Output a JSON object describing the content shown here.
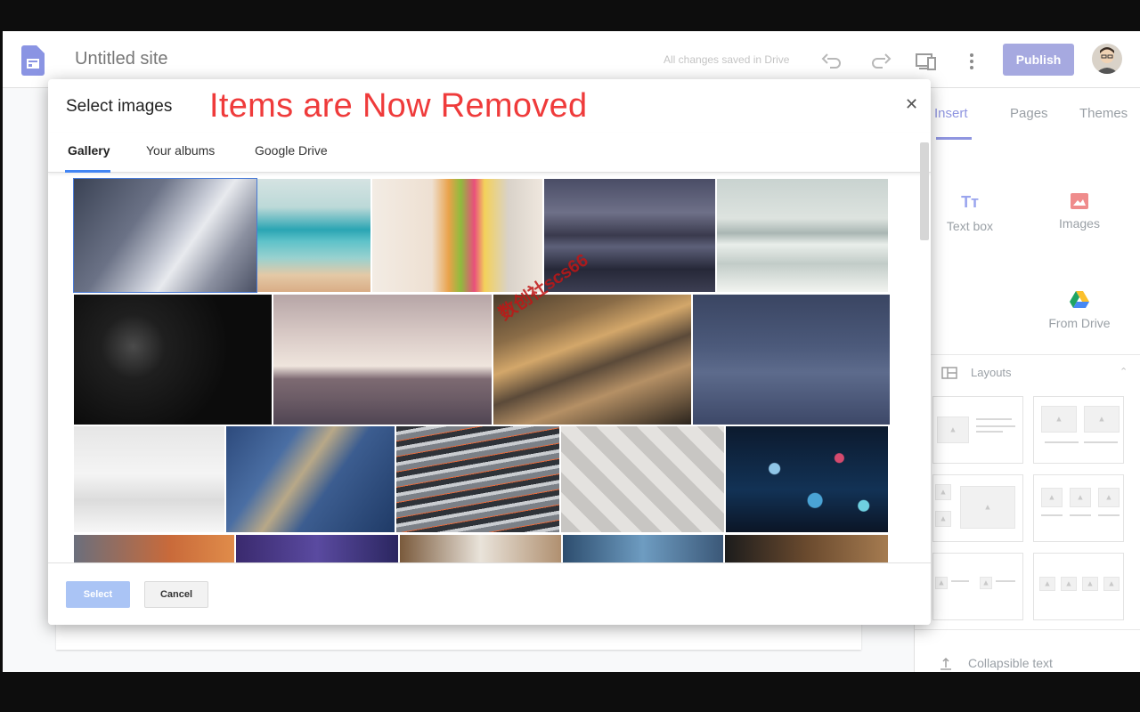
{
  "header": {
    "site_title": "Untitled site",
    "save_status": "All changes saved in Drive",
    "publish_label": "Publish"
  },
  "right_panel": {
    "tabs": [
      "Insert",
      "Pages",
      "Themes"
    ],
    "active_tab": "Insert",
    "items": {
      "text_box": "Text box",
      "images": "Images",
      "from_drive": "From Drive"
    },
    "layouts_label": "Layouts",
    "collapsible_text": "Collapsible text"
  },
  "dialog": {
    "title": "Select images",
    "overlay_note": "Items are Now Removed",
    "tabs": [
      "Gallery",
      "Your albums",
      "Google Drive"
    ],
    "active_tab": "Gallery",
    "select_label": "Select",
    "cancel_label": "Cancel",
    "images": [
      {
        "name": "diagonal-planks"
      },
      {
        "name": "teal-sea"
      },
      {
        "name": "sticky-notes"
      },
      {
        "name": "ice-lake"
      },
      {
        "name": "frozen-shore"
      },
      {
        "name": "typewriter-keys"
      },
      {
        "name": "pink-horizon"
      },
      {
        "name": "bronze-blur"
      },
      {
        "name": "blue-ice-surface"
      },
      {
        "name": "white-snow"
      },
      {
        "name": "blue-dune"
      },
      {
        "name": "mixing-board"
      },
      {
        "name": "white-tiles"
      },
      {
        "name": "city-bokeh"
      },
      {
        "name": "orange-gradient"
      },
      {
        "name": "purple-graph"
      },
      {
        "name": "wooden-desk"
      },
      {
        "name": "blue-window"
      },
      {
        "name": "coffee-laptop"
      }
    ]
  },
  "watermark": "数创社scs66",
  "colors": {
    "accent": "#8f95e0",
    "publish": "#a6a9e0",
    "dialog_tab_indicator": "#4285f4",
    "overlay_note": "#ef3b3b"
  }
}
